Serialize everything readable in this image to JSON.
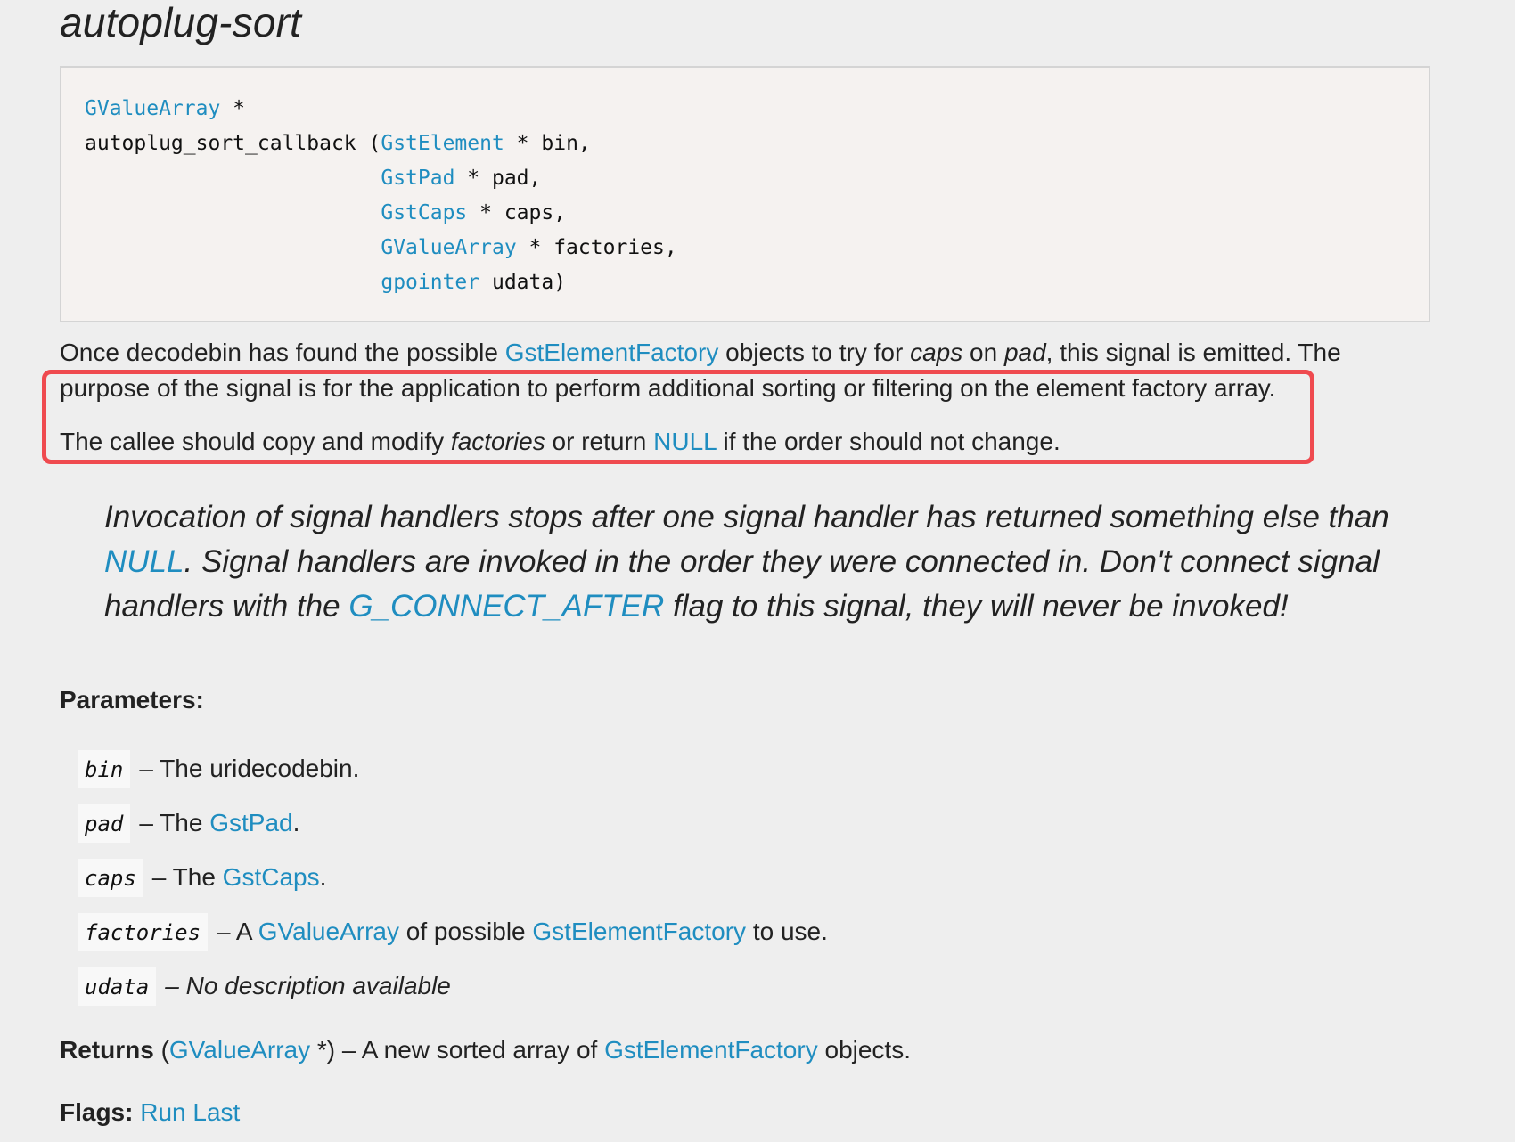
{
  "section_title": "autoplug-sort",
  "signature": {
    "return_type": "GValueArray",
    "return_ptr": " *",
    "function_name": "autoplug_sort_callback (",
    "params": [
      {
        "type": "GstElement",
        "rest": " * bin,"
      },
      {
        "type": "GstPad",
        "rest": " * pad,"
      },
      {
        "type": "GstCaps",
        "rest": " * caps,"
      },
      {
        "type": "GValueArray",
        "rest": " * factories,"
      },
      {
        "type": "gpointer",
        "rest": " udata)"
      }
    ]
  },
  "description": {
    "p1": {
      "t1": "Once decodebin has found the possible ",
      "link1": "GstElementFactory",
      "t2": " objects to try for ",
      "em1": "caps",
      "t3": " on ",
      "em2": "pad",
      "t4": ", this signal is emitted. The purpose of the signal is for the application to perform additional sorting or filtering on the element factory array."
    },
    "p2": {
      "t1": "The callee should copy and modify ",
      "em1": "factories",
      "t2": " or return ",
      "link1": "NULL",
      "t3": " if the order should not change."
    }
  },
  "note": {
    "t1": "Invocation of signal handlers stops after one signal handler has returned something else than ",
    "link1": "NULL",
    "t2": ". Signal handlers are invoked in the order they were connected in. Don't connect signal handlers with the ",
    "link2": "G_CONNECT_AFTER",
    "t3": " flag to this signal, they will never be invoked!"
  },
  "parameters": {
    "heading": "Parameters:",
    "items": [
      {
        "name": "bin",
        "t1": "– The uridecodebin.",
        "link": "",
        "t2": ""
      },
      {
        "name": "pad",
        "t1": "– The ",
        "link": "GstPad",
        "t2": "."
      },
      {
        "name": "caps",
        "t1": "– The ",
        "link": "GstCaps",
        "t2": "."
      },
      {
        "name": "factories",
        "t1": "– A ",
        "link": "GValueArray",
        "t2": " of possible ",
        "link2": "GstElementFactory",
        "t3": " to use."
      },
      {
        "name": "udata",
        "t1": "– No description available"
      }
    ]
  },
  "returns": {
    "label": "Returns",
    "t1": " (",
    "link1": "GValueArray",
    "t2": " *) – A new sorted array of ",
    "link2": "GstElementFactory",
    "t3": " objects."
  },
  "flags": {
    "label": "Flags:",
    "link": "Run Last"
  },
  "colors": {
    "link": "#1f8dc0",
    "highlight_border": "#ef4a4f",
    "background": "#eeeeee",
    "code_background": "#f5f2f0"
  }
}
